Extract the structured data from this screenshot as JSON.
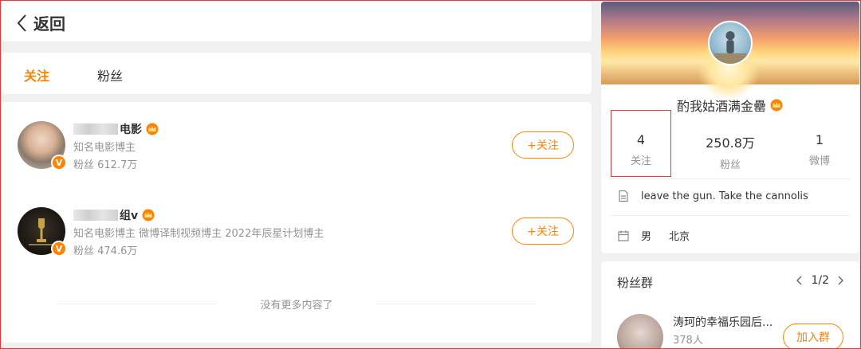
{
  "header": {
    "back_label": "返回"
  },
  "tabs": [
    {
      "label": "关注",
      "active": true
    },
    {
      "label": "粉丝",
      "active": false
    }
  ],
  "list": {
    "items": [
      {
        "name_visible": "电影",
        "desc": "知名电影博主",
        "fans": "粉丝 612.7万",
        "button": "+关注"
      },
      {
        "name_visible": "组v",
        "desc": "知名电影博主 微博译制视频博主 2022年辰星计划博主",
        "fans": "粉丝 474.6万",
        "button": "+关注"
      }
    ],
    "no_more": "没有更多内容了"
  },
  "profile": {
    "name": "酌我姑酒满金罍",
    "stats": [
      {
        "num": "4",
        "label": "关注"
      },
      {
        "num": "250.8万",
        "label": "粉丝"
      },
      {
        "num": "1",
        "label": "微博"
      }
    ],
    "bio": "leave the gun. Take the cannolis",
    "gender": "男",
    "location": "北京"
  },
  "fan_group": {
    "title": "粉丝群",
    "page": "1/2",
    "group_name": "涛珂的幸福乐园后...",
    "group_count": "378人",
    "join_label": "加入群"
  },
  "colors": {
    "accent": "#ff8200",
    "highlight": "#e23a3a"
  }
}
